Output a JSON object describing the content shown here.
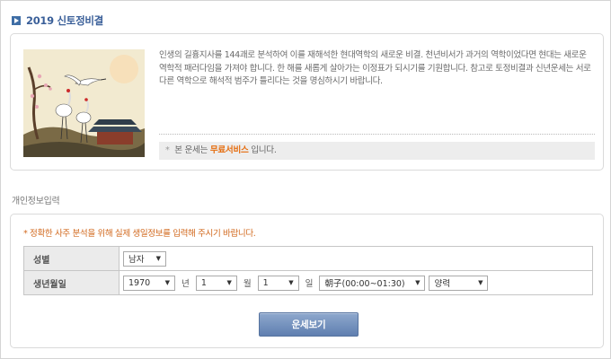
{
  "page": {
    "title": "2019 신토정비결"
  },
  "intro": {
    "image_alt": "학과 매화, 기와집이 그려진 전통 산수화",
    "paragraph": "인생의 길흉지사를 144괘로 분석하여 이를 재해석한 현대역학의 새로운 비결. 천년비서가 과거의 역학이었다면 현대는 새로운 역학적 패러다임을 가져야 합니다. 한 해를 새롭게 살아가는 이정표가 되시기를 기원합니다. 참고로 토정비결과 신년운세는 서로 다른 역학으로 해석적 범주가 틀리다는 것을 명심하시기 바랍니다.",
    "notice_bullet": "*",
    "notice_prefix": "본 운세는",
    "notice_highlight": "무료서비스",
    "notice_suffix": "입니다."
  },
  "section": {
    "label": "개인정보입력"
  },
  "form": {
    "notice": "* 정확한 사주 분석을 위해 실제 생일정보를 입력해 주시기 바랍니다.",
    "rows": {
      "gender": {
        "label": "성별",
        "value": "남자"
      },
      "birth": {
        "label": "생년월일",
        "year": "1970",
        "year_unit": "년",
        "month": "1",
        "month_unit": "월",
        "day": "1",
        "day_unit": "일",
        "hour": "朝子(00:00~01:30)",
        "calendar": "양력"
      }
    },
    "submit_label": "운세보기"
  },
  "colors": {
    "title": "#3a5f99",
    "highlight": "#e56d10",
    "notice": "#d2691e",
    "button": "#6f8dbc"
  }
}
